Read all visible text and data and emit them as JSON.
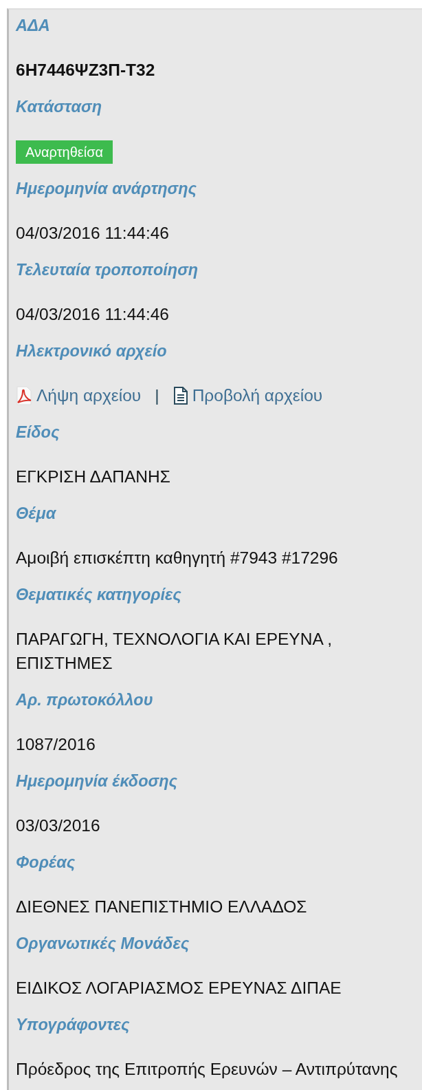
{
  "fields": [
    {
      "label": "ΑΔΑ",
      "kind": "code",
      "value": "6Η7446ΨΖ3Π-Τ32"
    },
    {
      "label": "Κατάσταση",
      "kind": "status",
      "value": "Αναρτηθείσα",
      "color": "#3dbb4e"
    },
    {
      "label": "Ημερομηνία ανάρτησης",
      "kind": "text",
      "value": "04/03/2016 11:44:46"
    },
    {
      "label": "Τελευταία τροποποίηση",
      "kind": "text",
      "value": "04/03/2016 11:44:46"
    },
    {
      "label": "Ηλεκτρονικό αρχείο",
      "kind": "files",
      "links": [
        {
          "kind": "pdf",
          "text": "Λήψη αρχείου"
        },
        {
          "kind": "doc",
          "text": "Προβολή αρχείου"
        }
      ],
      "separator": "|"
    },
    {
      "label": "Είδος",
      "kind": "text",
      "value": "ΕΓΚΡΙΣΗ ΔΑΠΑΝΗΣ"
    },
    {
      "label": "Θέμα",
      "kind": "text",
      "value": "Αμοιβή επισκέπτη καθηγητή #7943 #17296"
    },
    {
      "label": "Θεματικές κατηγορίες",
      "kind": "text",
      "value": "ΠΑΡΑΓΩΓΗ, ΤΕΧΝΟΛΟΓΙΑ ΚΑΙ ΕΡΕΥΝΑ , ΕΠΙΣΤΗΜΕΣ"
    },
    {
      "label": "Αρ. πρωτοκόλλου",
      "kind": "text",
      "value": "1087/2016"
    },
    {
      "label": "Ημερομηνία έκδοσης",
      "kind": "text",
      "value": "03/03/2016"
    },
    {
      "label": "Φορέας",
      "kind": "text",
      "value": "ΔΙΕΘΝΕΣ ΠΑΝΕΠΙΣΤΗΜΙΟ ΕΛΛΑΔΟΣ"
    },
    {
      "label": "Οργανωτικές Μονάδες",
      "kind": "text",
      "value": "ΕΙΔΙΚΟΣ ΛΟΓΑΡΙΑΣΜΟΣ ΕΡΕΥΝΑΣ ΔΙΠΑΕ"
    },
    {
      "label": "Υπογράφοντες",
      "kind": "text",
      "value": "Πρόεδρος της Επιτροπής Ερευνών – Αντιπρύτανης"
    }
  ]
}
